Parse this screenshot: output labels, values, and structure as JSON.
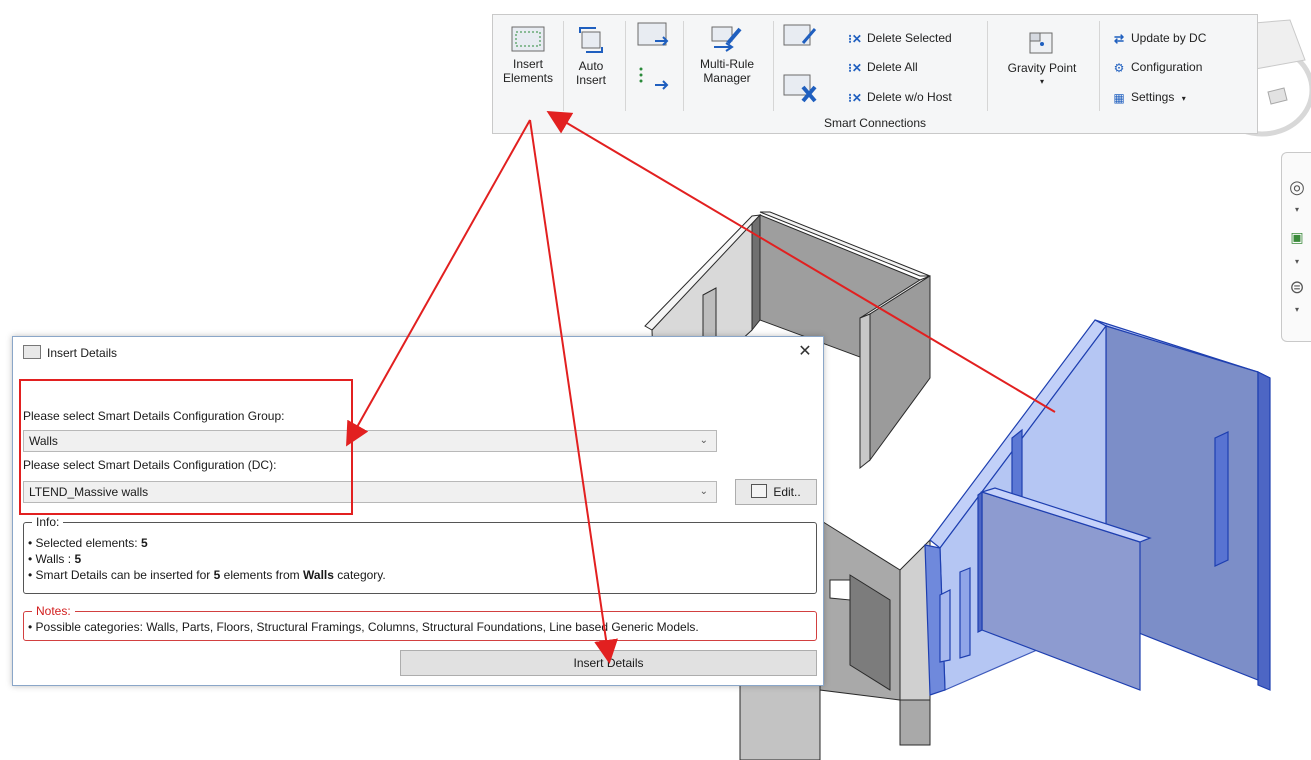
{
  "ribbon": {
    "insert_elements": [
      "Insert",
      "Elements"
    ],
    "auto_insert": [
      "Auto",
      "Insert"
    ],
    "multi_rule": [
      "Multi-Rule",
      "Manager"
    ],
    "delete_selected": "Delete Selected",
    "delete_all": "Delete All",
    "delete_wo_host": "Delete w/o Host",
    "gravity_point": "Gravity Point",
    "update_by_dc": "Update by DC",
    "configuration": "Configuration",
    "settings": "Settings",
    "panel_title": "Smart Connections"
  },
  "dialog": {
    "title": "Insert Details",
    "close_glyph": "✕",
    "group_label": "Please select Smart Details Configuration Group:",
    "group_value": "Walls",
    "dc_label": "Please select Smart Details Configuration (DC):",
    "dc_value": "LTEND_Massive walls",
    "edit_button": "Edit..",
    "info": {
      "legend": "Info:",
      "selected_prefix": "• Selected elements:",
      "selected_count": "5",
      "walls_prefix": "• Walls :",
      "walls_count": "5",
      "can_prefix": "• Smart Details can be inserted for",
      "can_count": "5",
      "can_middle": "elements from",
      "can_category": "Walls",
      "can_suffix": "category."
    },
    "notes": {
      "legend": "Notes:",
      "line": "• Possible categories: Walls, Parts, Floors, Structural Framings, Columns, Structural Foundations, Line based Generic Models."
    },
    "insert_button": "Insert Details"
  },
  "colors": {
    "accent_red": "#e22020",
    "selected_wall_blue": "#3a64d8",
    "icon_blue": "#1f5fbf"
  }
}
